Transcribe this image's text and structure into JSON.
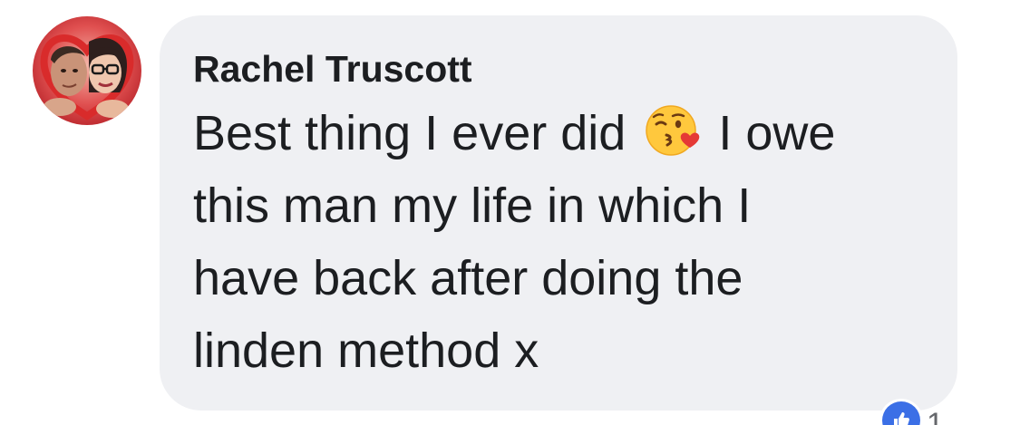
{
  "comment": {
    "author": "Rachel Truscott",
    "lines": [
      "Best thing I ever did",
      "I owe",
      "this man my life in which I",
      "have back after doing the",
      "linden method x"
    ],
    "emoji": "kissing-face-with-heart-emoji"
  },
  "reactions": {
    "icon": "thumbs-up-icon",
    "count": "1"
  },
  "colors": {
    "bubble": "#eff0f3",
    "text": "#1c1e21",
    "like": "#3b6fe6",
    "meta": "#65676b"
  }
}
